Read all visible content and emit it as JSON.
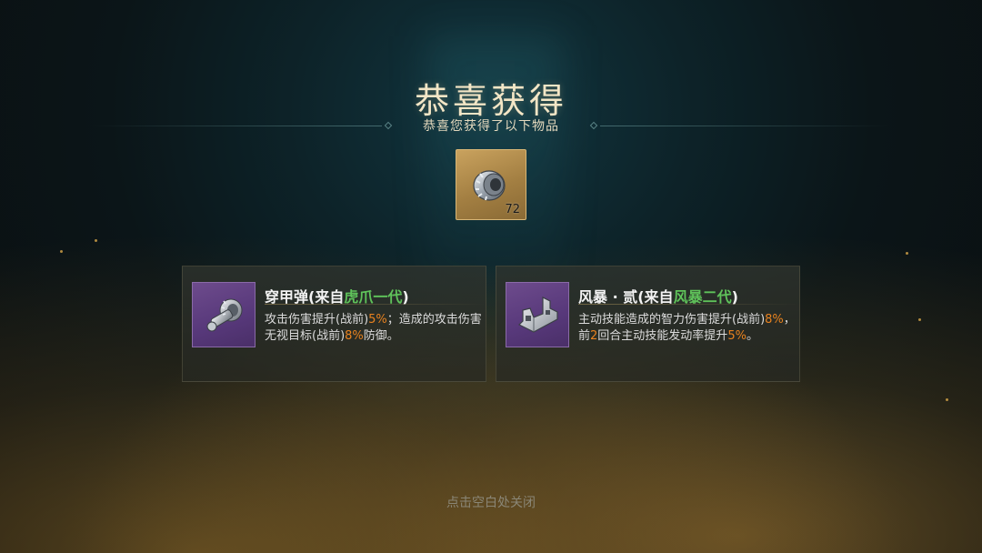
{
  "header": {
    "title": "恭喜获得",
    "subtitle": "恭喜您获得了以下物品"
  },
  "reward": {
    "icon": "gear-part-icon",
    "count": "72"
  },
  "cards": [
    {
      "icon": "armor-piercing-round-icon",
      "name": "穿甲弹",
      "from_open": "(来自",
      "from_source": "虎爪一代",
      "from_close": ")",
      "desc": [
        {
          "t": "攻击伤害提升(战前)",
          "hl": false
        },
        {
          "t": "5%",
          "hl": true
        },
        {
          "t": "；造成的攻击伤害无视目标(战前)",
          "hl": false
        },
        {
          "t": "8%",
          "hl": true
        },
        {
          "t": "防御。",
          "hl": false
        }
      ]
    },
    {
      "icon": "storm-bracket-icon",
      "name": "风暴 · 贰",
      "from_open": "(来自",
      "from_source": "风暴二代",
      "from_close": ")",
      "desc": [
        {
          "t": "主动技能造成的智力伤害提升(战前)",
          "hl": false
        },
        {
          "t": "8%",
          "hl": true
        },
        {
          "t": "，前",
          "hl": false
        },
        {
          "t": "2",
          "hl": true
        },
        {
          "t": "回合主动技能发动率提升",
          "hl": false
        },
        {
          "t": "5%",
          "hl": true
        },
        {
          "t": "。",
          "hl": false
        }
      ]
    }
  ],
  "footer": {
    "close_hint": "点击空白处关闭"
  },
  "colors": {
    "highlight": "#e8821f",
    "source_green": "#5fc25a",
    "reward_slot_gold": "#b48c4c",
    "card_icon_purple": "#5e3f80"
  }
}
